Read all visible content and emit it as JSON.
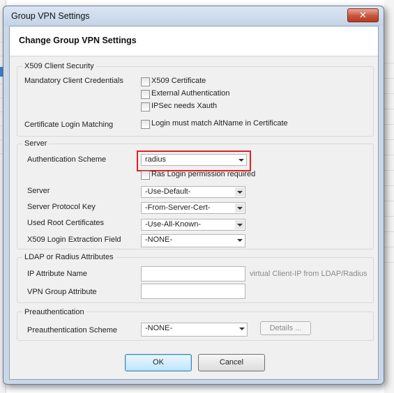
{
  "window": {
    "title": "Group VPN Settings",
    "close_glyph": "✕"
  },
  "header": {
    "title": "Change Group VPN Settings"
  },
  "x509_section": {
    "legend": "X509 Client Security",
    "mandatory_label": "Mandatory Client Credentials",
    "cert_login_label": "Certificate Login Matching",
    "options": {
      "x509_certificate": "X509 Certificate",
      "external_auth": "External Authentication",
      "ipsec_xauth": "IPSec needs Xauth",
      "altname_match": "Login must match AltName in Certificate"
    },
    "checked": {
      "x509_certificate": false,
      "external_auth": false,
      "ipsec_xauth": false,
      "altname_match": false
    }
  },
  "server_section": {
    "legend": "Server",
    "auth_scheme_label": "Authentication Scheme",
    "auth_scheme_value": "radius",
    "ras_login_label": "Ras Login permission required",
    "ras_login_checked": false,
    "server_label": "Server",
    "server_value": "-Use-Default-",
    "protocol_key_label": "Server Protocol Key",
    "protocol_key_value": "-From-Server-Cert-",
    "root_certs_label": "Used Root Certificates",
    "root_certs_value": "-Use-All-Known-",
    "extraction_label": "X509 Login Extraction Field",
    "extraction_value": "-NONE-",
    "highlight_color": "#e02020"
  },
  "ldap_section": {
    "legend": "LDAP or Radius Attributes",
    "ip_attr_label": "IP Attribute Name",
    "ip_attr_value": "",
    "ip_attr_hint": "virtual Client-IP from LDAP/Radius",
    "vpn_group_label": "VPN Group Attribute",
    "vpn_group_value": ""
  },
  "preauth_section": {
    "legend": "Preauthentication",
    "scheme_label": "Preauthentication Scheme",
    "scheme_value": "-NONE-",
    "details_button": "Details ..."
  },
  "footer": {
    "ok_button": "OK",
    "cancel_button": "Cancel"
  },
  "colors": {
    "titlebar": "#c9d7e8",
    "close_button": "#c9543c",
    "dialog_bg": "#f0f0f0",
    "default_button": "#bee6fd"
  }
}
